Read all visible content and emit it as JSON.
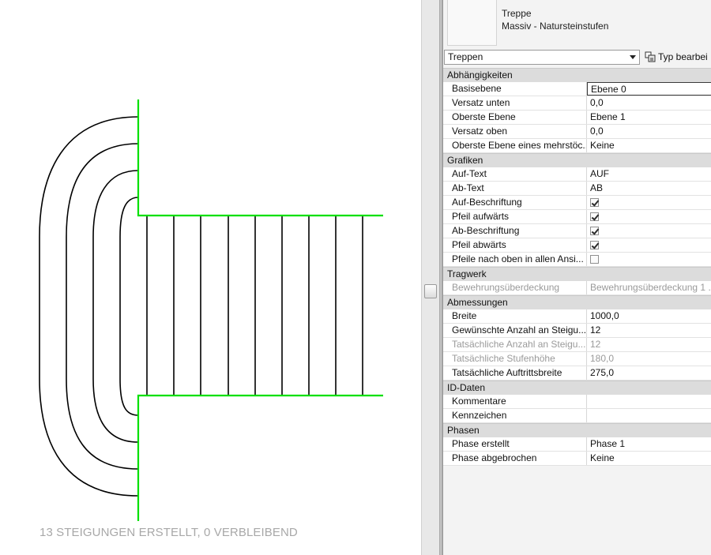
{
  "canvas": {
    "status_text": "13 STEIGUNGEN ERSTELLT, 0 VERBLEIBEND",
    "colors": {
      "boundary": "#00e000",
      "lines": "#000000"
    }
  },
  "properties": {
    "type_selector": {
      "family": "Treppe",
      "type": "Massiv - Natursteinstufen"
    },
    "filter": {
      "selected": "Treppen",
      "edit_type_label": "Typ bearbei"
    },
    "categories": [
      {
        "name": "Abhängigkeiten",
        "rows": [
          {
            "label": "Basisebene",
            "value": "Ebene 0"
          },
          {
            "label": "Versatz unten",
            "value": "0,0"
          },
          {
            "label": "Oberste Ebene",
            "value": "Ebene 1"
          },
          {
            "label": "Versatz oben",
            "value": "0,0"
          },
          {
            "label": "Oberste Ebene eines mehrstöc...",
            "value": "Keine"
          }
        ]
      },
      {
        "name": "Grafiken",
        "rows": [
          {
            "label": "Auf-Text",
            "value": "AUF"
          },
          {
            "label": "Ab-Text",
            "value": "AB"
          },
          {
            "label": "Auf-Beschriftung",
            "checked": true
          },
          {
            "label": "Pfeil aufwärts",
            "checked": true
          },
          {
            "label": "Ab-Beschriftung",
            "checked": true
          },
          {
            "label": "Pfeil abwärts",
            "checked": true
          },
          {
            "label": "Pfeile nach oben in allen Ansi...",
            "checked": false
          }
        ]
      },
      {
        "name": "Tragwerk",
        "rows": [
          {
            "label": "Bewehrungsüberdeckung",
            "value": "Bewehrungsüberdeckung 1 ..."
          }
        ]
      },
      {
        "name": "Abmessungen",
        "rows": [
          {
            "label": "Breite",
            "value": "1000,0"
          },
          {
            "label": "Gewünschte Anzahl an Steigu...",
            "value": "12"
          },
          {
            "label": "Tatsächliche Anzahl an Steigu...",
            "value": "12"
          },
          {
            "label": "Tatsächliche Stufenhöhe",
            "value": "180,0"
          },
          {
            "label": "Tatsächliche Auftrittsbreite",
            "value": "275,0"
          }
        ]
      },
      {
        "name": "ID-Daten",
        "rows": [
          {
            "label": "Kommentare",
            "value": ""
          },
          {
            "label": "Kennzeichen",
            "value": ""
          }
        ]
      },
      {
        "name": "Phasen",
        "rows": [
          {
            "label": "Phase erstellt",
            "value": "Phase 1"
          },
          {
            "label": "Phase abgebrochen",
            "value": "Keine"
          }
        ]
      }
    ]
  }
}
